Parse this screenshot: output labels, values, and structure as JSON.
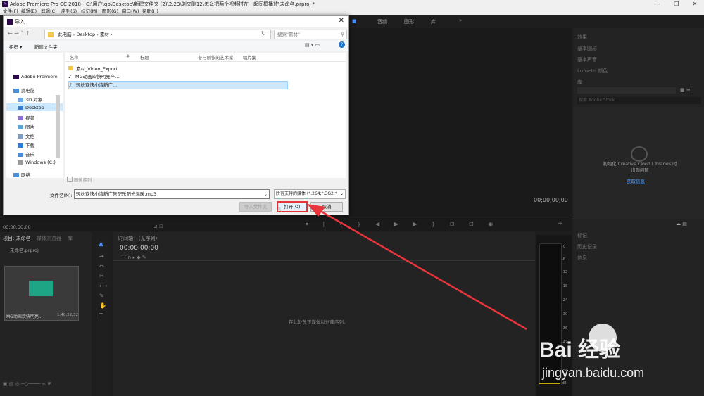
{
  "app": {
    "title": "Adobe Premiere Pro CC 2018 - C:\\用户\\qp\\Desktop\\新建文件夹 (2)\\2.23\\刘夹删12\\怎么把两个视频拼在一起同框播放\\未命名.prproj *",
    "logo_text": "Pr",
    "window_controls": [
      "—",
      "❐",
      "✕"
    ]
  },
  "menu": [
    "文件(F)",
    "编辑(E)",
    "剪辑(C)",
    "序列(S)",
    "标记(M)",
    "图形(G)",
    "窗口(W)",
    "帮助(H)"
  ],
  "workspace_tabs": [
    "音频",
    "图形",
    "库"
  ],
  "right_panel": {
    "items": [
      "效果",
      "基本图形",
      "基本声音",
      "Lumetri 颜色",
      "库"
    ],
    "stock_search": "搜索 Adobe Stock",
    "cc_message": "初始化 Creative Cloud Libraries 时出现问题",
    "cc_link": "获取信息",
    "lower_items": [
      "标记",
      "历史记录",
      "信息"
    ]
  },
  "program": {
    "timecode": "00;00;00;00"
  },
  "source": {
    "timecode": "00;00;00;00"
  },
  "project": {
    "tabs": [
      "项目: 未命名",
      "媒体浏览器",
      "库"
    ],
    "file": "未命名.prproj",
    "clip_name": "MG动画欢快明亮...",
    "clip_duration": "1:40;22/32"
  },
  "timeline": {
    "tab": "时间轴：（无序列）",
    "timecode": "00;00;00;00",
    "empty_msg": "在此处放下媒体以创建序列。"
  },
  "meter": {
    "labels": [
      "0",
      "-6",
      "-12",
      "-18",
      "-24",
      "-30",
      "-36",
      "-42",
      "-48",
      "-54",
      "dB"
    ]
  },
  "dialog": {
    "title": "导入",
    "close": "✕",
    "breadcrumb": [
      "此电脑",
      "Desktop",
      "素材"
    ],
    "search_placeholder": "搜索\"素材\"",
    "organize": "组织 ▾",
    "new_folder": "新建文件夹",
    "nav": {
      "top": "Adobe Premiere",
      "pc": "此电脑",
      "items": [
        "3D 对象",
        "Desktop",
        "视频",
        "图片",
        "文档",
        "下载",
        "音乐",
        "Windows (C:)"
      ],
      "network": "网络"
    },
    "columns": [
      "名称",
      "#",
      "标题",
      "参与创作的艺术家",
      "唱片集"
    ],
    "files": [
      {
        "name": "素材_Video_Export",
        "type": "folder"
      },
      {
        "name": "MG动画欢快明亮产...",
        "type": "audio"
      },
      {
        "name": "轻松欢快小清新广...",
        "type": "audio",
        "selected": true
      }
    ],
    "image_sequence": "图像序列",
    "filename_label": "文件名(N):",
    "filename_value": "轻松欢快小清新广告配乐阳光温暖.mp3",
    "filter": "所有支持的媒体 (*.264;*.3G2;*",
    "import_folder": "导入文件夹",
    "open": "打开(O)",
    "cancel": "取消"
  },
  "watermark": {
    "brand": "Bai 经验",
    "url": "jingyan.baidu.com"
  },
  "colors": {
    "accent": "#e8343b",
    "selection": "#cce8ff",
    "link": "#4a9eff"
  }
}
